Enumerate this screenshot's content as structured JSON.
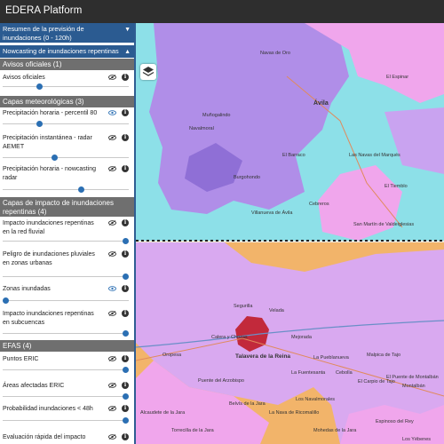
{
  "app": {
    "title": "EDERA Platform"
  },
  "sidebar": {
    "sections": [
      {
        "label": "Resumen de la previsión de inundaciones (0 - 120h)",
        "chevron": "chevron-down"
      },
      {
        "label": "Nowcasting de inundaciones repentinas",
        "chevron": "chevron-up"
      }
    ],
    "groups": {
      "avisos": {
        "title": "Avisos oficiales (1)",
        "items": [
          {
            "label": "Avisos oficiales",
            "opacity": 0.5
          }
        ]
      },
      "meteo": {
        "title": "Capas meteorológicas (3)",
        "items": [
          {
            "label": "Precipitación horaria - percentil 80",
            "opacity": 0.5,
            "active": true
          },
          {
            "label": "Precipitación instantánea - radar AEMET",
            "opacity": 0.5
          },
          {
            "label": "Precipitación horaria - nowcasting radar",
            "opacity": 0.63
          }
        ]
      },
      "impacto": {
        "title": "Capas de impacto de inundaciones repentinas (4)",
        "items": [
          {
            "label": "Impacto inundaciones repentinas en la red fluvial",
            "opacity": 1.0
          },
          {
            "label": "Peligro de inundaciones pluviales en zonas urbanas",
            "opacity": 1.0
          },
          {
            "label": "Zonas inundadas",
            "opacity": 0.0,
            "active": true
          },
          {
            "label": "Impacto inundaciones repentinas en subcuencas",
            "opacity": 1.0
          }
        ]
      },
      "efas": {
        "title": "EFAS (4)",
        "items": [
          {
            "label": "Puntos ERIC",
            "opacity": 1.0
          },
          {
            "label": "Áreas afectadas ERIC",
            "opacity": 1.0
          },
          {
            "label": "Probabilidad inundaciones < 48h",
            "opacity": 1.0
          },
          {
            "label": "Evaluación rápida del impacto",
            "opacity": 1.0
          }
        ]
      }
    }
  },
  "map": {
    "layers_button": "layers-icon",
    "top_places": [
      "El Espinar",
      "Navas de Oro",
      "Ávila",
      "El Barraco",
      "El Tiemblo",
      "San Martín de Valdeiglesias",
      "Villanueva de Ávila",
      "Cebreros",
      "Las Navas del Marqués",
      "Burgohondo",
      "Navalmoral",
      "Muñogalindo"
    ],
    "bottom_places": [
      "Talavera de la Reina",
      "La Pueblanueva",
      "Oropesa",
      "Mejorada",
      "Puente del Arzobispo",
      "Cebolla",
      "El Carpio de Tajo",
      "Los Navalmorales",
      "La Nava de Ricomalillo",
      "Belvís de la Jara",
      "Alcaudete de la Jara",
      "Velada",
      "Calera y Chozas",
      "La Fuentesanta",
      "Malpica de Tajo",
      "El Puente de Montalbán",
      "Montalbán",
      "Torrecilla de la Jara",
      "Mohedas de la Jara",
      "Espinoso del Rey",
      "Los Yébenes",
      "Segurilla"
    ],
    "colors": {
      "purple": "#b08ee8",
      "cyan": "#8de0e8",
      "pink": "#f0a6ec",
      "orange": "#f2b46a",
      "lilac": "#d9a9f0",
      "dark_red": "#c2293b"
    }
  }
}
